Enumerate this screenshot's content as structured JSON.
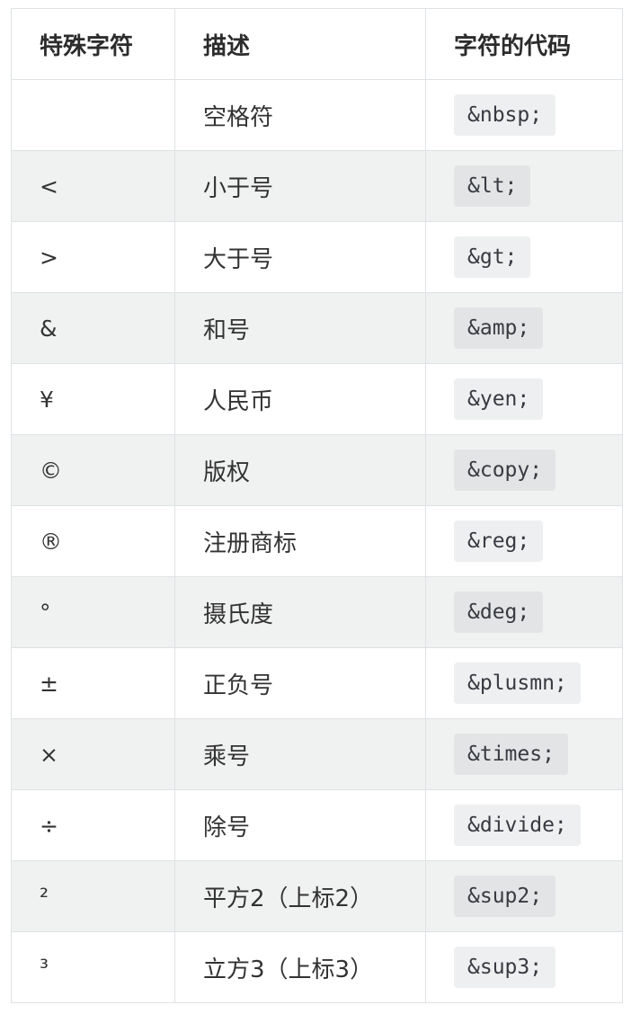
{
  "table": {
    "headers": [
      "特殊字符",
      "描述",
      "字符的代码"
    ],
    "rows": [
      {
        "char": " ",
        "desc": "空格符",
        "code": "&nbsp;"
      },
      {
        "char": "<",
        "desc": "小于号",
        "code": "&lt;"
      },
      {
        "char": ">",
        "desc": "大于号",
        "code": "&gt;"
      },
      {
        "char": "&",
        "desc": "和号",
        "code": "&amp;"
      },
      {
        "char": "¥",
        "desc": "人民币",
        "code": "&yen;"
      },
      {
        "char": "©",
        "desc": "版权",
        "code": "&copy;"
      },
      {
        "char": "®",
        "desc": "注册商标",
        "code": "&reg;"
      },
      {
        "char": "°",
        "desc": "摄氏度",
        "code": "&deg;"
      },
      {
        "char": "±",
        "desc": "正负号",
        "code": "&plusmn;"
      },
      {
        "char": "×",
        "desc": "乘号",
        "code": "&times;"
      },
      {
        "char": "÷",
        "desc": "除号",
        "code": "&divide;"
      },
      {
        "char": "²",
        "desc": "平方2（上标2）",
        "code": "&sup2;"
      },
      {
        "char": "³",
        "desc": "立方3（上标3）",
        "code": "&sup3;"
      }
    ]
  }
}
